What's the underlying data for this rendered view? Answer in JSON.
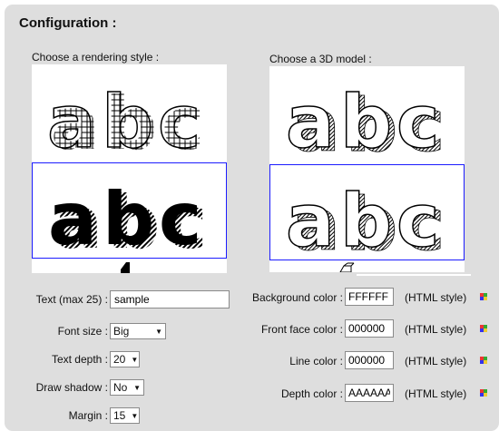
{
  "title": "Configuration :",
  "rendering": {
    "label": "Choose a rendering style :",
    "options": [
      "abc",
      "abc",
      "abc"
    ],
    "selected_index": 1
  },
  "model": {
    "label": "Choose a 3D model :",
    "options": [
      "abc",
      "abc",
      "abc"
    ],
    "selected_index": 1
  },
  "form": {
    "text": {
      "label": "Text (max 25) :",
      "value": "sample"
    },
    "font_size": {
      "label": "Font size :",
      "value": "Big"
    },
    "text_depth": {
      "label": "Text depth :",
      "value": "20"
    },
    "draw_shadow": {
      "label": "Draw shadow :",
      "value": "No"
    },
    "margin": {
      "label": "Margin :",
      "value": "15"
    }
  },
  "colors": {
    "hint": "(HTML style)",
    "background": {
      "label": "Background color :",
      "value": "FFFFFF"
    },
    "front_face": {
      "label": "Front face color :",
      "value": "000000"
    },
    "line": {
      "label": "Line color :",
      "value": "000000"
    },
    "depth": {
      "label": "Depth color :",
      "value": "AAAAAA"
    }
  }
}
